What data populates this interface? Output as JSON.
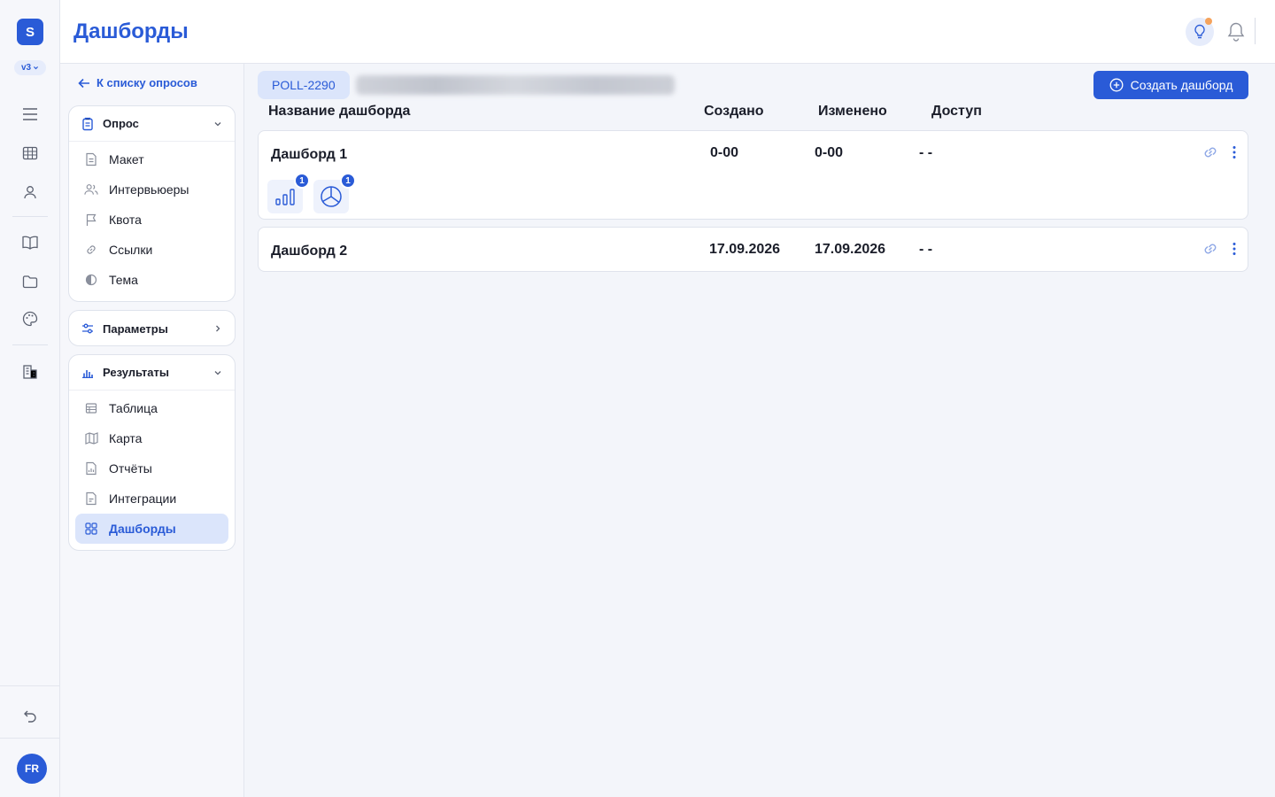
{
  "app": {
    "logo_letter": "S",
    "version": "v3",
    "user_initials": "FR"
  },
  "rail": {
    "icons": [
      "menu-icon",
      "table-icon",
      "user-icon",
      "book-icon",
      "folder-icon",
      "palette-icon",
      "building-icon"
    ],
    "bottom_icon": "undo-icon"
  },
  "header": {
    "title": "Дашборды"
  },
  "sidebar": {
    "back_label": "К списку опросов",
    "survey_section": {
      "title": "Опрос",
      "items": [
        {
          "label": "Макет",
          "icon": "document-icon"
        },
        {
          "label": "Интервьюеры",
          "icon": "users-icon"
        },
        {
          "label": "Квота",
          "icon": "flag-icon"
        },
        {
          "label": "Ссылки",
          "icon": "link-icon"
        },
        {
          "label": "Тема",
          "icon": "contrast-icon"
        }
      ]
    },
    "params_section": {
      "title": "Параметры"
    },
    "results_section": {
      "title": "Результаты",
      "items": [
        {
          "label": "Таблица",
          "icon": "table-icon"
        },
        {
          "label": "Карта",
          "icon": "map-icon"
        },
        {
          "label": "Отчёты",
          "icon": "report-icon"
        },
        {
          "label": "Интеграции",
          "icon": "integration-icon"
        },
        {
          "label": "Дашборды",
          "icon": "grid-icon",
          "active": true
        }
      ]
    }
  },
  "main": {
    "poll_id": "POLL-2290",
    "create_button": "Создать дашборд",
    "columns": {
      "name": "Название дашборда",
      "created": "Создано",
      "modified": "Изменено",
      "access": "Доступ"
    },
    "dashboards": [
      {
        "name": "Дашборд 1",
        "created": "0-00",
        "modified": "0-00",
        "access": "- -",
        "widgets": [
          {
            "type": "bar-chart",
            "count": "1"
          },
          {
            "type": "pie-chart",
            "count": "1"
          }
        ]
      },
      {
        "name": "Дашборд 2",
        "created": "17.09.2026",
        "modified": "17.09.2026",
        "access": "- -"
      }
    ]
  },
  "colors": {
    "accent": "#2a5bd7",
    "accent_light": "#dbe5fb",
    "notification_dot": "#f5a35c"
  }
}
